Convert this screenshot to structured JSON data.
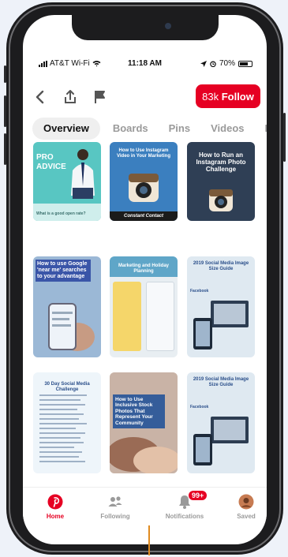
{
  "status_bar": {
    "carrier": "AT&T Wi-Fi",
    "time": "11:18 AM",
    "battery": "70%"
  },
  "toolbar": {
    "follow_count": "83k",
    "follow_label": "Follow",
    "icons": [
      "back-icon",
      "share-icon",
      "flag-icon"
    ]
  },
  "tabs": [
    "Overview",
    "Boards",
    "Pins",
    "Videos",
    "Fo"
  ],
  "pins": {
    "pin1": {
      "title": "PRO ADVICE",
      "caption": "What is a good open rate?"
    },
    "pin2": {
      "title": "How to Use Instagram Video in Your Marketing",
      "brand": "Constant Contact"
    },
    "pin3": {
      "title": "How to Run an Instagram Photo Challenge"
    },
    "pin4": {
      "title": "How to use Google 'near me' searches to your advantage"
    },
    "pin5": {
      "title": "Marketing and Holiday Planning"
    },
    "pin6": {
      "title": "2019 Social Media Image Size Guide",
      "sub": "Facebook"
    },
    "pin7": {
      "title": "30 Day Social Media Challenge"
    },
    "pin8": {
      "title": "How to Use Inclusive Stock Photos That Represent Your Community"
    },
    "pin9": {
      "title": "2019 Social Media Image Size Guide",
      "sub": "Facebook"
    }
  },
  "bottom_nav": [
    {
      "label": "Home",
      "icon": "pinterest-logo-icon"
    },
    {
      "label": "Following",
      "icon": "people-icon"
    },
    {
      "label": "Notifications",
      "icon": "bell-icon",
      "badge": "99+"
    },
    {
      "label": "Saved",
      "icon": "profile-avatar-icon"
    }
  ],
  "colors": {
    "accent": "#e60023",
    "phone": "#1c1c1e"
  }
}
